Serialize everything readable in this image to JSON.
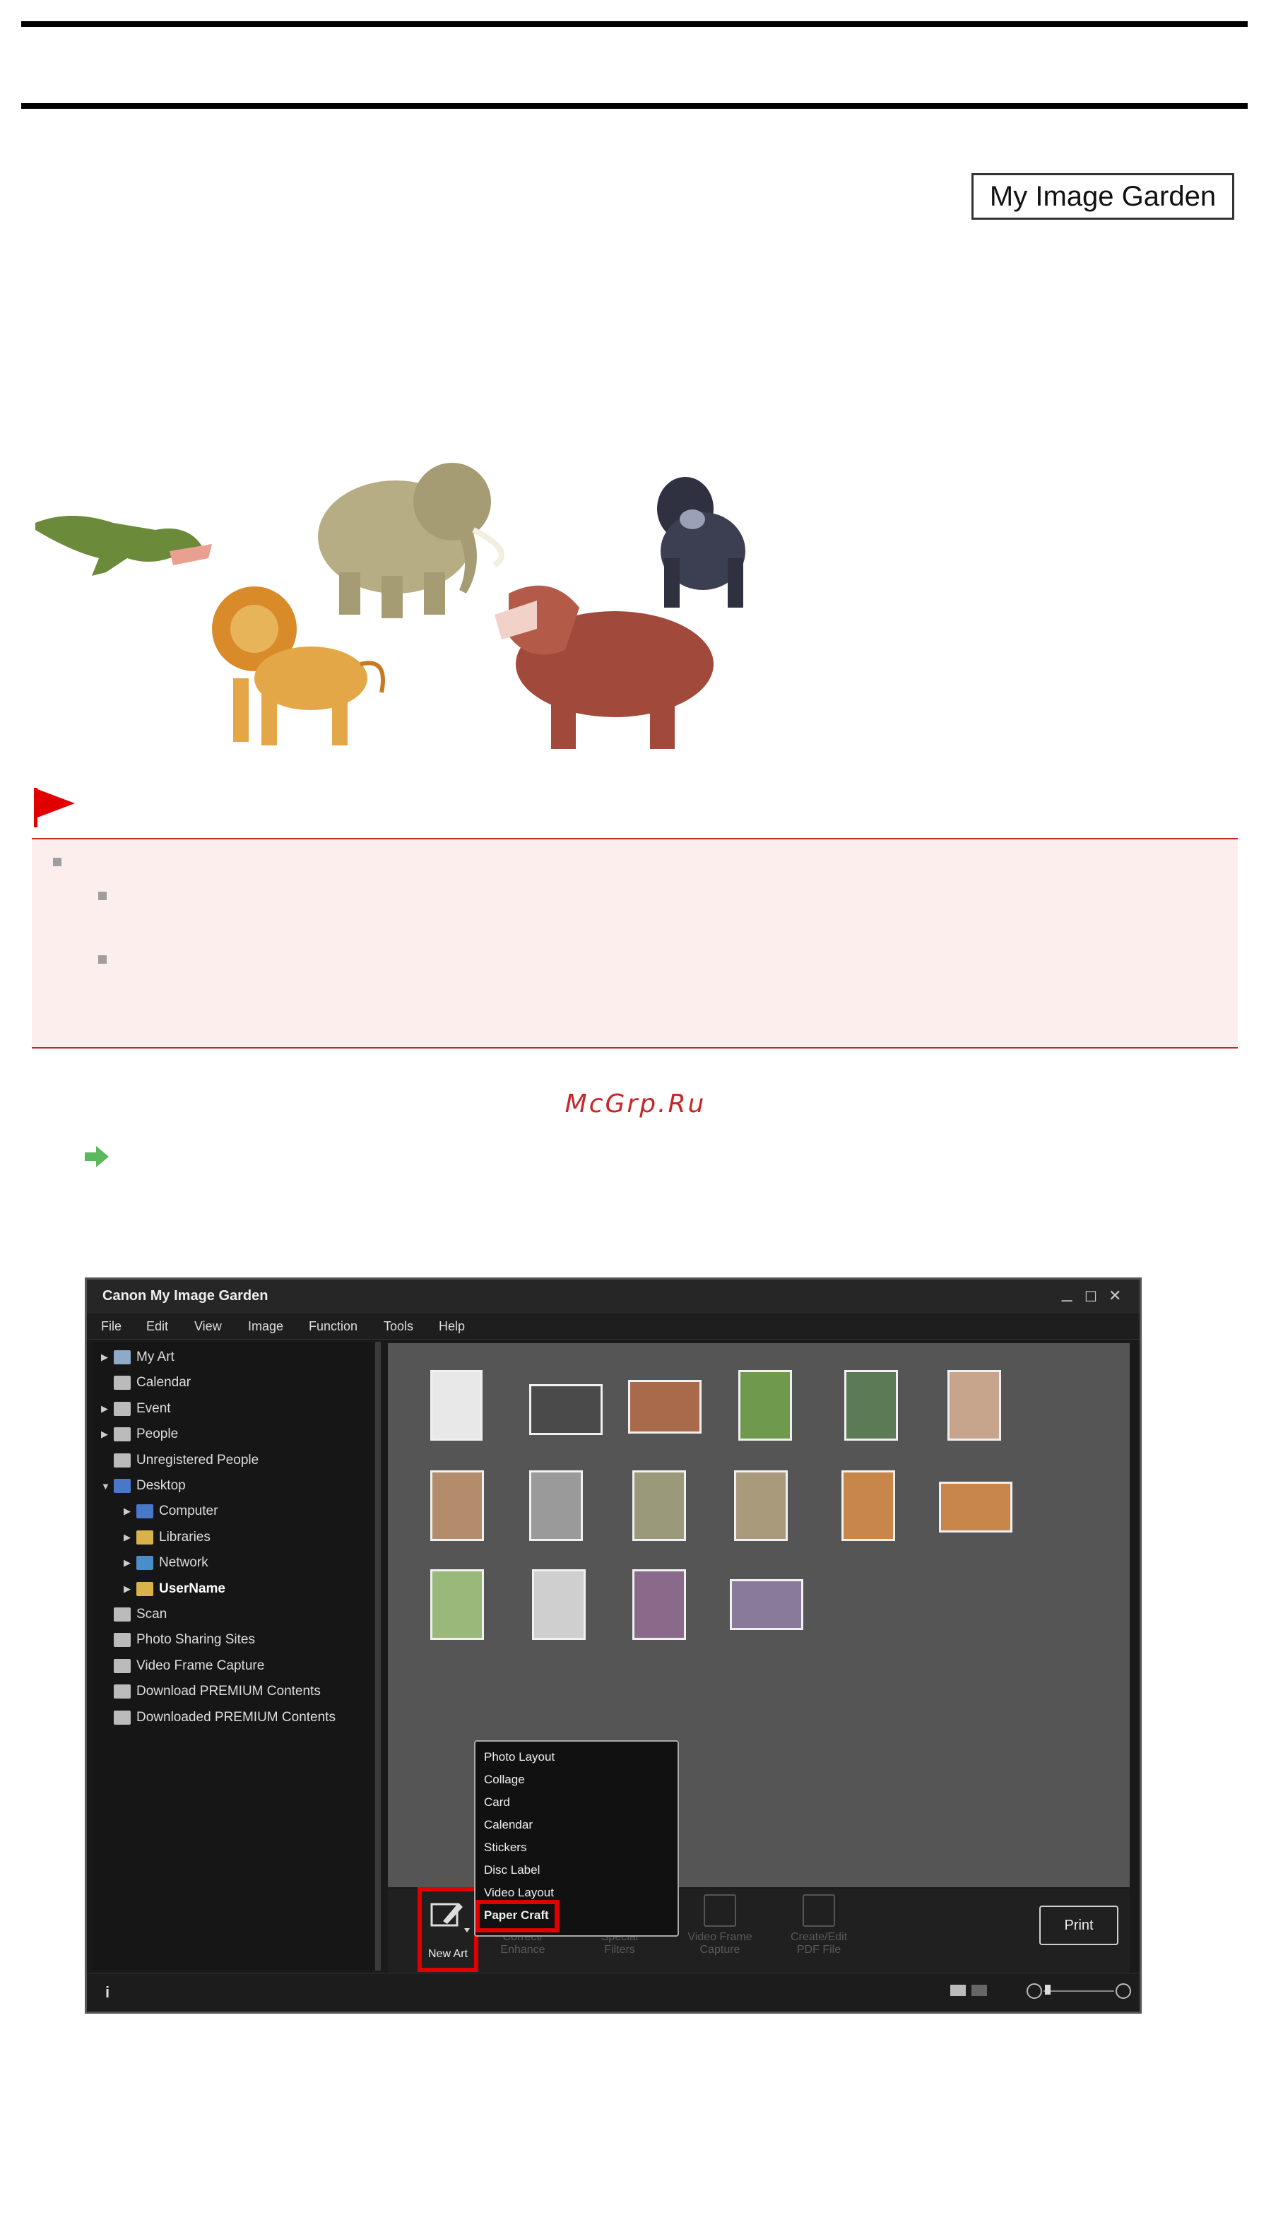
{
  "header": {
    "product_badge": "My Image Garden"
  },
  "watermark": "McGrp.Ru",
  "window": {
    "title": "Canon My Image Garden",
    "controls": {
      "minimize": "_",
      "maximize": "☐",
      "close": "✕"
    },
    "menu": [
      "File",
      "Edit",
      "View",
      "Image",
      "Function",
      "Tools",
      "Help"
    ],
    "tree": [
      {
        "label": "My Art",
        "expand": "▶",
        "indent": 0,
        "bold": false,
        "icon": "my-art"
      },
      {
        "label": "Calendar",
        "expand": "",
        "indent": 0,
        "bold": false,
        "icon": "calendar"
      },
      {
        "label": "Event",
        "expand": "▶",
        "indent": 0,
        "bold": false,
        "icon": "event"
      },
      {
        "label": "People",
        "expand": "▶",
        "indent": 0,
        "bold": false,
        "icon": "people"
      },
      {
        "label": "Unregistered People",
        "expand": "",
        "indent": 0,
        "bold": false,
        "icon": "unregistered-people"
      },
      {
        "label": "Desktop",
        "expand": "▼",
        "indent": 0,
        "bold": false,
        "icon": "desktop"
      },
      {
        "label": "Computer",
        "expand": "▶",
        "indent": 1,
        "bold": false,
        "icon": "computer"
      },
      {
        "label": "Libraries",
        "expand": "▶",
        "indent": 1,
        "bold": false,
        "icon": "libraries"
      },
      {
        "label": "Network",
        "expand": "▶",
        "indent": 1,
        "bold": false,
        "icon": "network"
      },
      {
        "label": "UserName",
        "expand": "▶",
        "indent": 1,
        "bold": true,
        "icon": "user-folder"
      },
      {
        "label": "Scan",
        "expand": "",
        "indent": 0,
        "bold": false,
        "icon": "scan"
      },
      {
        "label": "Photo Sharing Sites",
        "expand": "",
        "indent": 0,
        "bold": false,
        "icon": "photo-sharing"
      },
      {
        "label": "Video Frame Capture",
        "expand": "",
        "indent": 0,
        "bold": false,
        "icon": "video-frame"
      },
      {
        "label": "Download PREMIUM Contents",
        "expand": "",
        "indent": 0,
        "bold": false,
        "icon": "download-premium"
      },
      {
        "label": "Downloaded PREMIUM Contents",
        "expand": "",
        "indent": 0,
        "bold": false,
        "icon": "folder"
      }
    ],
    "toolbar": {
      "new_art": "New Art",
      "correct_enhance": "Correct/ Enhance",
      "special_filters": "Special Filters",
      "video_frame_capture": "Video Frame Capture",
      "create_pdf": "Create/Edit PDF File",
      "print": "Print"
    },
    "new_art_menu": [
      "Photo Layout",
      "Collage",
      "Card",
      "Calendar",
      "Stickers",
      "Disc Label",
      "Video Layout",
      "Paper Craft"
    ],
    "status": {
      "info": "i"
    }
  },
  "colors": {
    "highlight_red": "#e00000",
    "note_bg": "#fdeeee",
    "note_border": "#c62828"
  }
}
